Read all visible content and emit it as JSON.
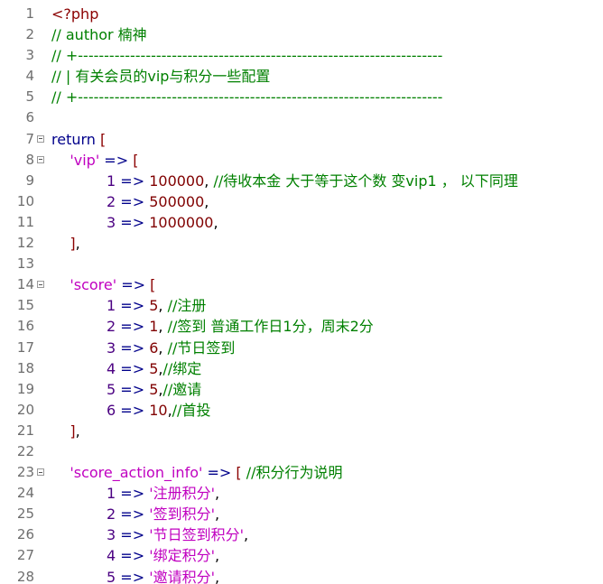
{
  "editor": {
    "lines": [
      {
        "n": "1",
        "indent": "",
        "fold": false,
        "tokens": [
          {
            "t": "<?php",
            "c": "php"
          }
        ]
      },
      {
        "n": "2",
        "indent": "",
        "fold": false,
        "tokens": [
          {
            "t": "// author 楠神",
            "c": "cm"
          }
        ]
      },
      {
        "n": "3",
        "indent": "",
        "fold": false,
        "tokens": [
          {
            "t": "// +----------------------------------------------------------------------",
            "c": "cm"
          }
        ]
      },
      {
        "n": "4",
        "indent": "",
        "fold": false,
        "tokens": [
          {
            "t": "// | 有关会员的vip与积分一些配置",
            "c": "cm"
          }
        ]
      },
      {
        "n": "5",
        "indent": "",
        "fold": false,
        "tokens": [
          {
            "t": "// +----------------------------------------------------------------------",
            "c": "cm"
          }
        ]
      },
      {
        "n": "6",
        "indent": "",
        "fold": false,
        "tokens": []
      },
      {
        "n": "7",
        "indent": "",
        "fold": true,
        "tokens": [
          {
            "t": "return",
            "c": "kw"
          },
          {
            "t": " [",
            "c": "br"
          }
        ]
      },
      {
        "n": "8",
        "indent": "    ",
        "fold": true,
        "tokens": [
          {
            "t": "'vip'",
            "c": "str"
          },
          {
            "t": " => ",
            "c": "op"
          },
          {
            "t": "[",
            "c": "br"
          }
        ]
      },
      {
        "n": "9",
        "indent": "            ",
        "fold": false,
        "tokens": [
          {
            "t": "1",
            "c": "key"
          },
          {
            "t": " => ",
            "c": "op"
          },
          {
            "t": "100000",
            "c": "num"
          },
          {
            "t": ", ",
            "c": "punct"
          },
          {
            "t": "//待收本金 大于等于这个数 变vip1 ， 以下同理",
            "c": "cm"
          }
        ]
      },
      {
        "n": "10",
        "indent": "            ",
        "fold": false,
        "tokens": [
          {
            "t": "2",
            "c": "key"
          },
          {
            "t": " => ",
            "c": "op"
          },
          {
            "t": "500000",
            "c": "num"
          },
          {
            "t": ",",
            "c": "punct"
          }
        ]
      },
      {
        "n": "11",
        "indent": "            ",
        "fold": false,
        "tokens": [
          {
            "t": "3",
            "c": "key"
          },
          {
            "t": " => ",
            "c": "op"
          },
          {
            "t": "1000000",
            "c": "num"
          },
          {
            "t": ",",
            "c": "punct"
          }
        ]
      },
      {
        "n": "12",
        "indent": "    ",
        "fold": false,
        "tokens": [
          {
            "t": "]",
            "c": "br"
          },
          {
            "t": ",",
            "c": "punct"
          }
        ]
      },
      {
        "n": "13",
        "indent": "",
        "fold": false,
        "tokens": []
      },
      {
        "n": "14",
        "indent": "    ",
        "fold": true,
        "tokens": [
          {
            "t": "'score'",
            "c": "str"
          },
          {
            "t": " => ",
            "c": "op"
          },
          {
            "t": "[",
            "c": "br"
          }
        ]
      },
      {
        "n": "15",
        "indent": "            ",
        "fold": false,
        "tokens": [
          {
            "t": "1",
            "c": "key"
          },
          {
            "t": " => ",
            "c": "op"
          },
          {
            "t": "5",
            "c": "num"
          },
          {
            "t": ", ",
            "c": "punct"
          },
          {
            "t": "//注册",
            "c": "cm"
          }
        ]
      },
      {
        "n": "16",
        "indent": "            ",
        "fold": false,
        "tokens": [
          {
            "t": "2",
            "c": "key"
          },
          {
            "t": " => ",
            "c": "op"
          },
          {
            "t": "1",
            "c": "num"
          },
          {
            "t": ", ",
            "c": "punct"
          },
          {
            "t": "//签到 普通工作日1分，周末2分",
            "c": "cm"
          }
        ]
      },
      {
        "n": "17",
        "indent": "            ",
        "fold": false,
        "tokens": [
          {
            "t": "3",
            "c": "key"
          },
          {
            "t": " => ",
            "c": "op"
          },
          {
            "t": "6",
            "c": "num"
          },
          {
            "t": ", ",
            "c": "punct"
          },
          {
            "t": "//节日签到",
            "c": "cm"
          }
        ]
      },
      {
        "n": "18",
        "indent": "            ",
        "fold": false,
        "tokens": [
          {
            "t": "4",
            "c": "key"
          },
          {
            "t": " => ",
            "c": "op"
          },
          {
            "t": "5",
            "c": "num"
          },
          {
            "t": ",",
            "c": "punct"
          },
          {
            "t": "//绑定",
            "c": "cm"
          }
        ]
      },
      {
        "n": "19",
        "indent": "            ",
        "fold": false,
        "tokens": [
          {
            "t": "5",
            "c": "key"
          },
          {
            "t": " => ",
            "c": "op"
          },
          {
            "t": "5",
            "c": "num"
          },
          {
            "t": ",",
            "c": "punct"
          },
          {
            "t": "//邀请",
            "c": "cm"
          }
        ]
      },
      {
        "n": "20",
        "indent": "            ",
        "fold": false,
        "tokens": [
          {
            "t": "6",
            "c": "key"
          },
          {
            "t": " => ",
            "c": "op"
          },
          {
            "t": "10",
            "c": "num"
          },
          {
            "t": ",",
            "c": "punct"
          },
          {
            "t": "//首投",
            "c": "cm"
          }
        ]
      },
      {
        "n": "21",
        "indent": "    ",
        "fold": false,
        "tokens": [
          {
            "t": "]",
            "c": "br"
          },
          {
            "t": ",",
            "c": "punct"
          }
        ]
      },
      {
        "n": "22",
        "indent": "",
        "fold": false,
        "tokens": []
      },
      {
        "n": "23",
        "indent": "    ",
        "fold": true,
        "tokens": [
          {
            "t": "'score_action_info'",
            "c": "str"
          },
          {
            "t": " => ",
            "c": "op"
          },
          {
            "t": "[",
            "c": "br"
          },
          {
            "t": " ",
            "c": "punct"
          },
          {
            "t": "//积分行为说明",
            "c": "cm"
          }
        ]
      },
      {
        "n": "24",
        "indent": "            ",
        "fold": false,
        "tokens": [
          {
            "t": "1",
            "c": "key"
          },
          {
            "t": " => ",
            "c": "op"
          },
          {
            "t": "'注册积分'",
            "c": "str"
          },
          {
            "t": ",",
            "c": "punct"
          }
        ]
      },
      {
        "n": "25",
        "indent": "            ",
        "fold": false,
        "tokens": [
          {
            "t": "2",
            "c": "key"
          },
          {
            "t": " => ",
            "c": "op"
          },
          {
            "t": "'签到积分'",
            "c": "str"
          },
          {
            "t": ",",
            "c": "punct"
          }
        ]
      },
      {
        "n": "26",
        "indent": "            ",
        "fold": false,
        "tokens": [
          {
            "t": "3",
            "c": "key"
          },
          {
            "t": " => ",
            "c": "op"
          },
          {
            "t": "'节日签到积分'",
            "c": "str"
          },
          {
            "t": ",",
            "c": "punct"
          }
        ]
      },
      {
        "n": "27",
        "indent": "            ",
        "fold": false,
        "tokens": [
          {
            "t": "4",
            "c": "key"
          },
          {
            "t": " => ",
            "c": "op"
          },
          {
            "t": "'绑定积分'",
            "c": "str"
          },
          {
            "t": ",",
            "c": "punct"
          }
        ]
      },
      {
        "n": "28",
        "indent": "            ",
        "fold": false,
        "tokens": [
          {
            "t": "5",
            "c": "key"
          },
          {
            "t": " => ",
            "c": "op"
          },
          {
            "t": "'邀请积分'",
            "c": "str"
          },
          {
            "t": ",",
            "c": "punct"
          }
        ]
      }
    ]
  },
  "colors": {
    "keyword": "#00008b",
    "comment": "#008000",
    "string": "#c000c0",
    "number": "#800000",
    "line_number": "#6e6e6e"
  },
  "icons": {
    "fold_marker": "minus-box-icon"
  }
}
